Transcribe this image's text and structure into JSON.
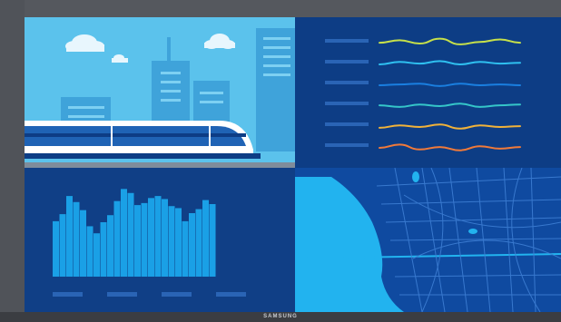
{
  "brand": {
    "label": "SAMSUNG"
  },
  "panels": {
    "city_train": {
      "title": ""
    },
    "line_chart": {
      "title": ""
    },
    "bar_chart": {
      "title": ""
    },
    "map": {
      "title": ""
    }
  },
  "colors": {
    "sky": "#5bc2ec",
    "panel_dark": "#0d3d85",
    "bar_cyan": "#1aa0e6",
    "map_water": "#22b3ef",
    "map_land": "#0f4aa0",
    "line1": "#c6e04a",
    "line2": "#2fc0f0",
    "line3": "#1a7fe0",
    "line4": "#35c6c9",
    "line5": "#f0b23a",
    "line6": "#f07a3a"
  },
  "chart_data": [
    {
      "type": "line",
      "title": "",
      "xlabel": "",
      "ylabel": "",
      "series": [
        {
          "values": [
            0.55,
            0.7,
            0.5,
            0.8,
            0.45,
            0.6,
            0.75,
            0.55
          ]
        },
        {
          "values": [
            0.5,
            0.65,
            0.55,
            0.7,
            0.5,
            0.65,
            0.55,
            0.6
          ]
        },
        {
          "values": [
            0.5,
            0.55,
            0.6,
            0.45,
            0.6,
            0.5,
            0.55,
            0.5
          ]
        },
        {
          "values": [
            0.55,
            0.45,
            0.6,
            0.5,
            0.65,
            0.45,
            0.55,
            0.6
          ]
        },
        {
          "values": [
            0.45,
            0.6,
            0.5,
            0.65,
            0.4,
            0.6,
            0.5,
            0.55
          ]
        },
        {
          "values": [
            0.5,
            0.7,
            0.4,
            0.55,
            0.35,
            0.6,
            0.45,
            0.55
          ]
        }
      ]
    },
    {
      "type": "bar",
      "title": "",
      "xlabel": "",
      "ylabel": "",
      "values": [
        55,
        62,
        80,
        74,
        66,
        50,
        43,
        54,
        61,
        75,
        87,
        83,
        71,
        73,
        78,
        80,
        77,
        70,
        68,
        55,
        63,
        67,
        76,
        72
      ]
    }
  ]
}
